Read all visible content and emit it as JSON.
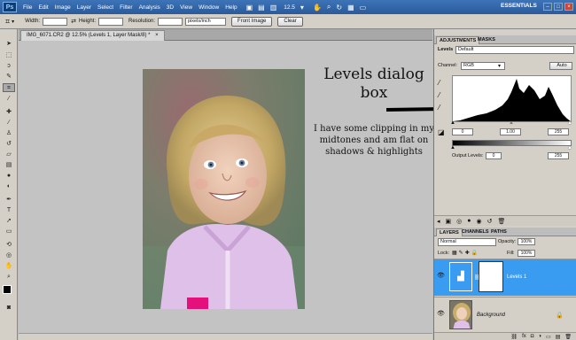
{
  "app": {
    "logo": "Ps"
  },
  "menu": [
    "File",
    "Edit",
    "Image",
    "Layer",
    "Select",
    "Filter",
    "Analysis",
    "3D",
    "View",
    "Window",
    "Help"
  ],
  "menubar": {
    "zoom": "12.5",
    "workspace": "ESSENTIALS",
    "minimize": "–",
    "maximize": "□",
    "close": "×"
  },
  "options": {
    "width_label": "Width:",
    "height_label": "Height:",
    "resolution_label": "Resolution:",
    "res_unit": "pixels/inch",
    "front_image": "Front Image",
    "clear": "Clear"
  },
  "document": {
    "tab": "IMG_6071.CR2 @ 12.5% (Levels 1, Layer Mask/8) *",
    "close": "×"
  },
  "annotation": {
    "title": "Levels dialog box",
    "body": "I have some clipping in my midtones and am flat on shadows & highlights"
  },
  "adjustments": {
    "tabs": [
      "ADJUSTMENTS",
      "MASKS"
    ],
    "type": "Levels",
    "preset": "Default",
    "channel_label": "Channel:",
    "channel": "RGB",
    "auto": "Auto",
    "input_black": "0",
    "input_gamma": "1.00",
    "input_white": "255",
    "output_label": "Output Levels:",
    "output_black": "0",
    "output_white": "255"
  },
  "layers": {
    "tabs": [
      "LAYERS",
      "CHANNELS",
      "PATHS"
    ],
    "blend_mode": "Normal",
    "opacity_label": "Opacity:",
    "opacity": "100%",
    "lock_label": "Lock:",
    "fill_label": "Fill:",
    "fill": "100%",
    "items": [
      {
        "name": "Levels 1",
        "selected": true
      },
      {
        "name": "Background",
        "selected": false
      }
    ]
  },
  "colors": {
    "accent": "#3a9cf0",
    "menubar": "#2f63a6"
  }
}
